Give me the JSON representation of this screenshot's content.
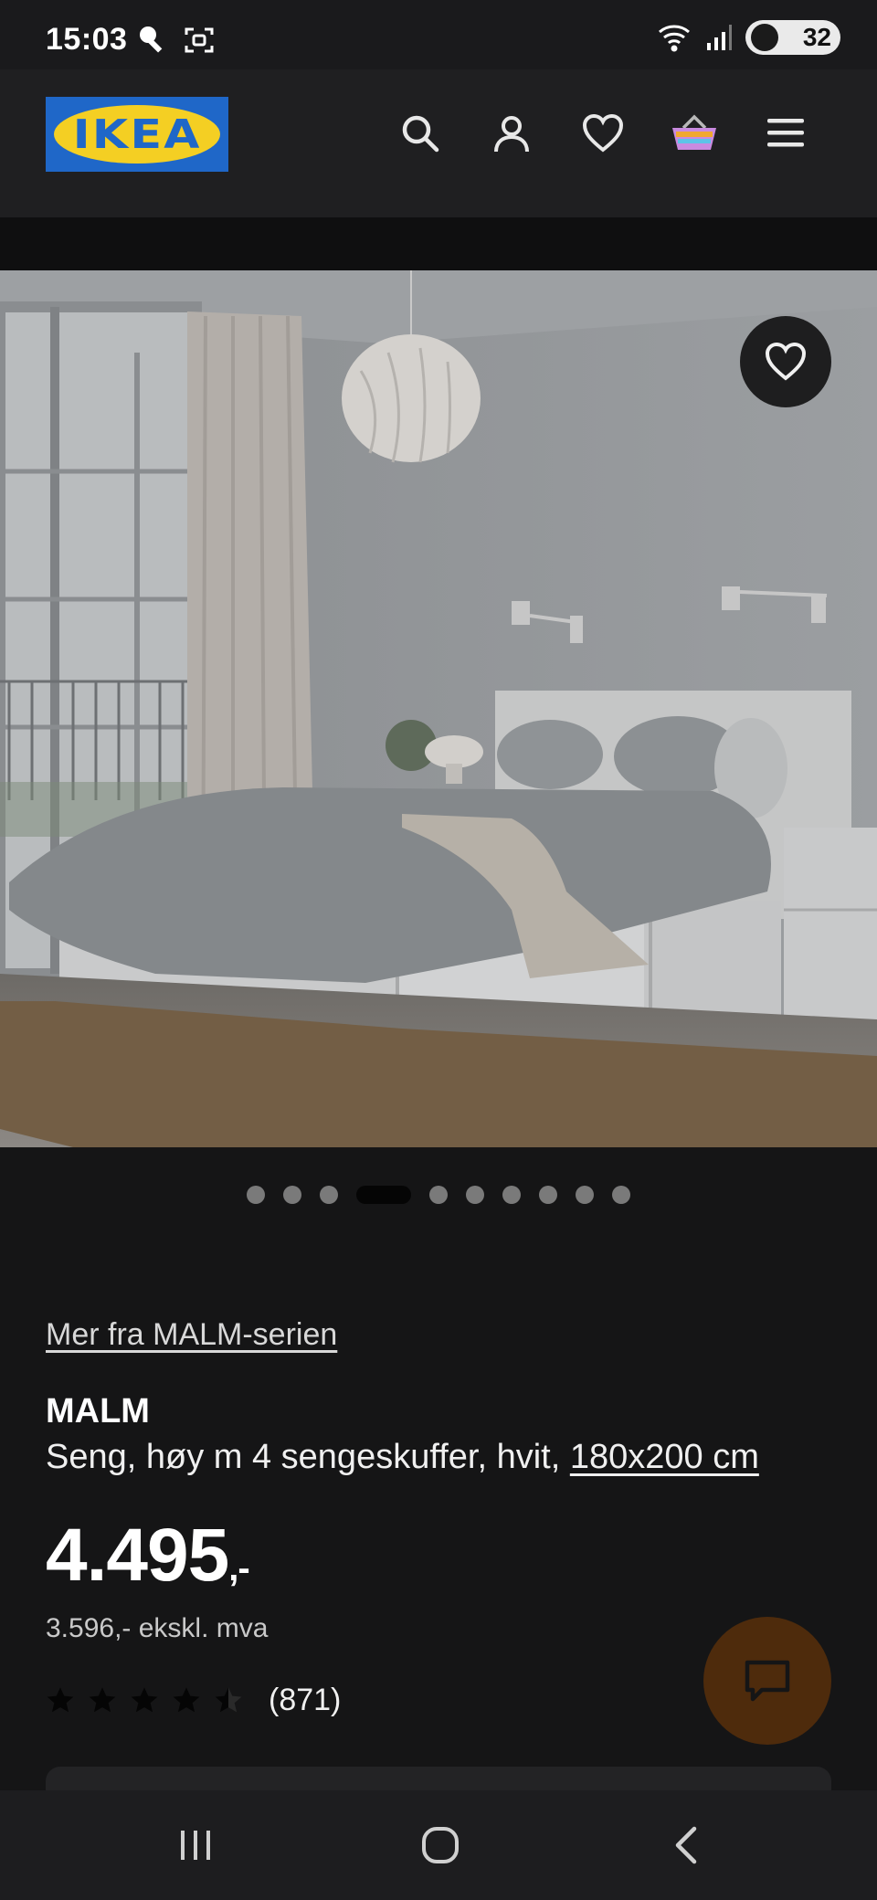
{
  "status_bar": {
    "time": "15:03",
    "battery": "32",
    "icons": [
      "key-icon",
      "screen-capture-icon",
      "wifi-icon",
      "signal-icon",
      "battery-icon"
    ]
  },
  "header": {
    "logo_text": "IKEA",
    "icons": [
      "search-icon",
      "account-icon",
      "wishlist-icon",
      "basket-icon",
      "menu-icon"
    ]
  },
  "hero": {
    "image_description_icon": "bedroom-photo",
    "favorite_icon": "heart-icon"
  },
  "carousel": {
    "total": 10,
    "active_index": 3
  },
  "product": {
    "series_link": "Mer fra MALM-serien",
    "name": "MALM",
    "description": "Seng, høy m 4 sengeskuffer, hvit,",
    "size_link": "180x200 cm",
    "price": "4.495",
    "price_suffix": ",-",
    "price_ex_vat": "3.596,- ekskl. mva",
    "rating": 4.5,
    "rating_count": "(871)"
  },
  "colors": {
    "ikea_blue": "#1f67c8",
    "ikea_yellow": "#f4cf23",
    "chat_button": "#4e2b0c",
    "background": "#151516"
  },
  "nav_bar": {
    "icons": [
      "recent-apps-icon",
      "home-icon",
      "back-icon"
    ]
  }
}
